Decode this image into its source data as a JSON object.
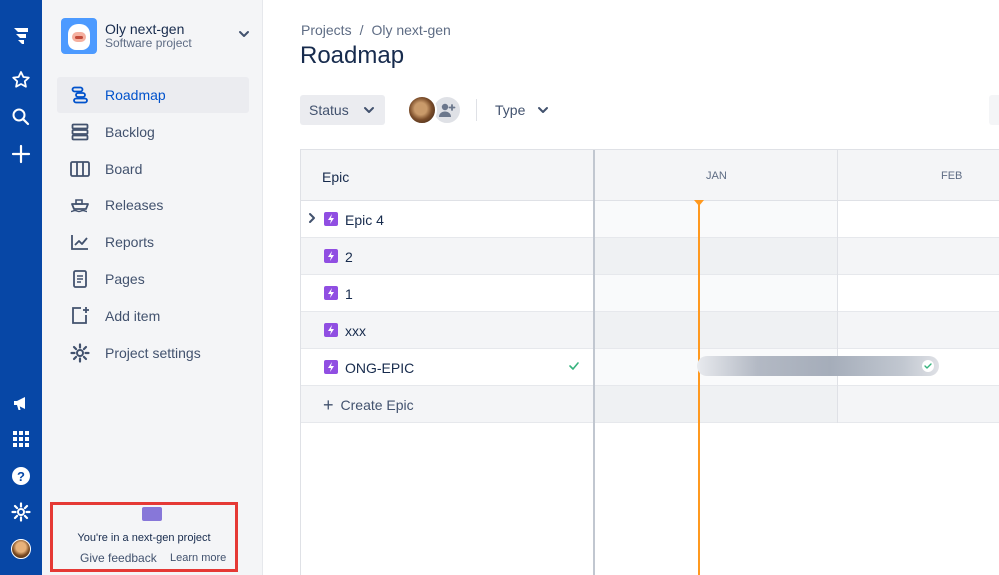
{
  "project": {
    "name": "Oly next-gen",
    "type": "Software project"
  },
  "sidebar": {
    "items": [
      {
        "label": "Roadmap",
        "icon": "roadmap-icon",
        "active": true
      },
      {
        "label": "Backlog",
        "icon": "backlog-icon"
      },
      {
        "label": "Board",
        "icon": "board-icon"
      },
      {
        "label": "Releases",
        "icon": "ship-icon"
      },
      {
        "label": "Reports",
        "icon": "chart-line-icon"
      },
      {
        "label": "Pages",
        "icon": "page-icon"
      },
      {
        "label": "Add item",
        "icon": "add-item-icon"
      },
      {
        "label": "Project settings",
        "icon": "gear-icon"
      }
    ]
  },
  "nextgen": {
    "title": "You're in a next-gen project",
    "feedback": "Give feedback",
    "learn_more": "Learn more"
  },
  "breadcrumb": {
    "root": "Projects",
    "separator": "/",
    "current": "Oly next-gen"
  },
  "page_title": "Roadmap",
  "toolbar": {
    "status_label": "Status",
    "type_label": "Type"
  },
  "roadmap": {
    "column_header": "Epic",
    "months": [
      "JAN",
      "FEB"
    ],
    "epics": [
      {
        "label": "Epic 4",
        "expandable": true,
        "done": false
      },
      {
        "label": "2",
        "expandable": false,
        "done": false
      },
      {
        "label": "1",
        "expandable": false,
        "done": false
      },
      {
        "label": "xxx",
        "expandable": false,
        "done": false
      },
      {
        "label": "ONG-EPIC",
        "expandable": false,
        "done": true
      }
    ],
    "create_label": "Create Epic"
  },
  "colors": {
    "global_nav": "#0747a6",
    "accent": "#0052cc",
    "epic": "#904ee2",
    "today_marker": "#ff991f",
    "highlight_box": "#e53935",
    "done_check": "#36b37e"
  }
}
